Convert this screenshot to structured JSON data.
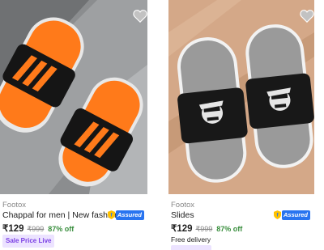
{
  "products": [
    {
      "brand": "Footox",
      "title": "Chappal for men | New fashion lat...",
      "assured": "Assured",
      "price": "₹129",
      "mrp": "₹999",
      "discount": "87% off",
      "tag": "Sale Price Live",
      "image_icon": "orange-black-slide-sandals"
    },
    {
      "brand": "Footox",
      "title": "Slides",
      "assured": "Assured",
      "price": "₹129",
      "mrp": "₹999",
      "discount": "87% off",
      "delivery": "Free delivery",
      "image_icon": "grey-black-face-print-slides"
    }
  ],
  "colors": {
    "assured_blue": "#2874f0",
    "discount_green": "#388e3c",
    "sale_tag_bg": "#ece3ff",
    "sale_tag_text": "#7b3fe4"
  }
}
